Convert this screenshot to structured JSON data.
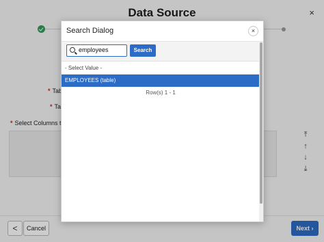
{
  "page": {
    "title": "Data Source",
    "close_symbol": "×",
    "fields": {
      "table_label_1": "Tab",
      "table_label_2": "Tab",
      "select_columns_label": "Select Columns to ba"
    },
    "shuttle": {
      "move_top": "⤒",
      "move_up": "↑",
      "move_down": "↓",
      "move_bottom": "⤓"
    },
    "footer": {
      "previous_symbol": "<",
      "cancel_label": "Cancel",
      "next_label": "Next ›"
    },
    "colors": {
      "accent": "#2d6cc6",
      "success": "#2f9e5a",
      "required": "#c0262d"
    }
  },
  "dialog": {
    "title": "Search Dialog",
    "close_symbol": "×",
    "search": {
      "value": "employees",
      "button_label": "Search"
    },
    "list": {
      "placeholder": "- Select Value -",
      "items": [
        "EMPLOYEES (table)"
      ],
      "selected_index": 0
    },
    "row_count": "Row(s) 1 - 1"
  }
}
